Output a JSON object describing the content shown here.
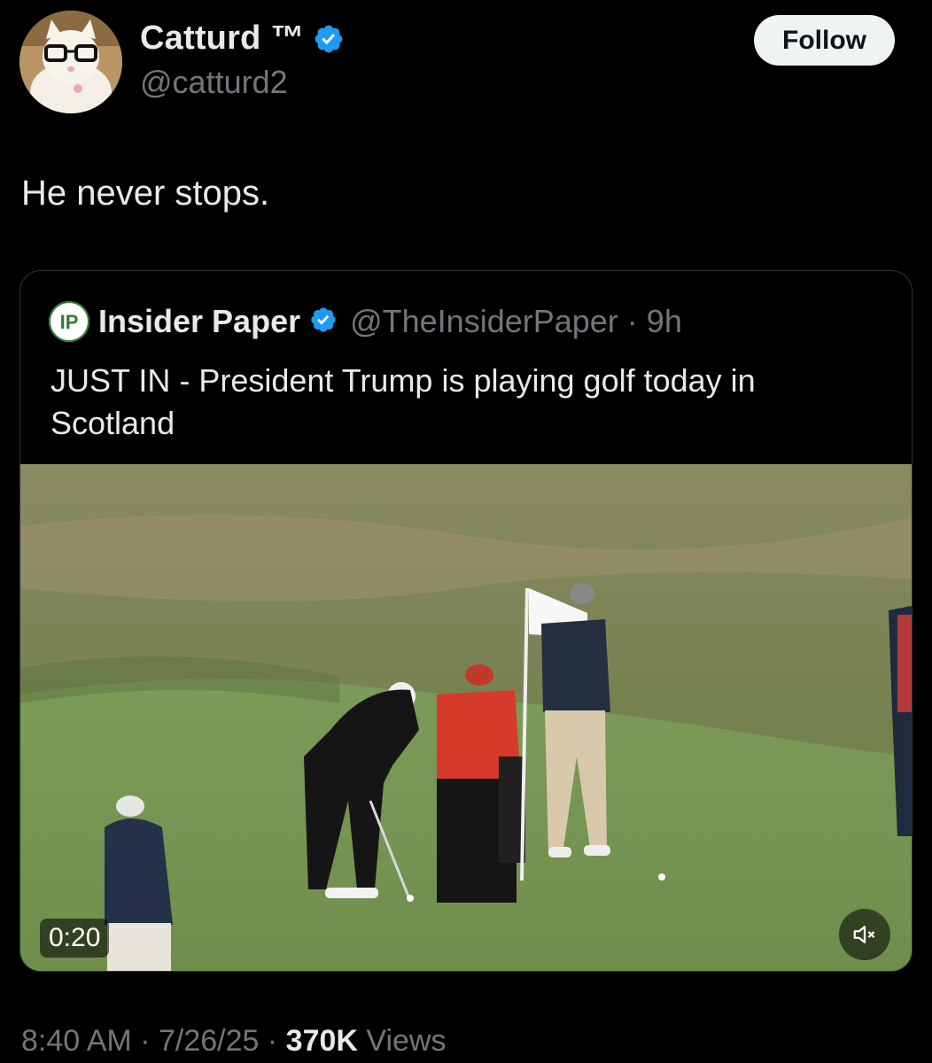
{
  "author": {
    "display_name": "Catturd ™",
    "handle": "@catturd2",
    "verified": true,
    "avatar_icon": "cat-with-glasses-avatar"
  },
  "follow_button": {
    "label": "Follow"
  },
  "tweet": {
    "text": "He never stops."
  },
  "quoted_tweet": {
    "avatar_text": "IP",
    "display_name": "Insider Paper",
    "handle": "@TheInsiderPaper",
    "separator": "·",
    "time": "9h",
    "text": "JUST IN - President Trump is playing golf today in Scotland",
    "media": {
      "type": "video",
      "description_icon": "golf-course-video-thumbnail",
      "duration": "0:20",
      "mute_icon": "speaker-muted-icon"
    }
  },
  "meta": {
    "time": "8:40 AM",
    "sep1": "·",
    "date": "7/26/25",
    "sep2": "·",
    "views_count": "370K",
    "views_label": "Views"
  },
  "colors": {
    "background": "#000000",
    "primary_text": "#e7e9ea",
    "secondary_text": "#71767b",
    "verified_blue": "#1d9bf0",
    "border": "#2f3336",
    "follow_bg": "#eff3f4"
  }
}
